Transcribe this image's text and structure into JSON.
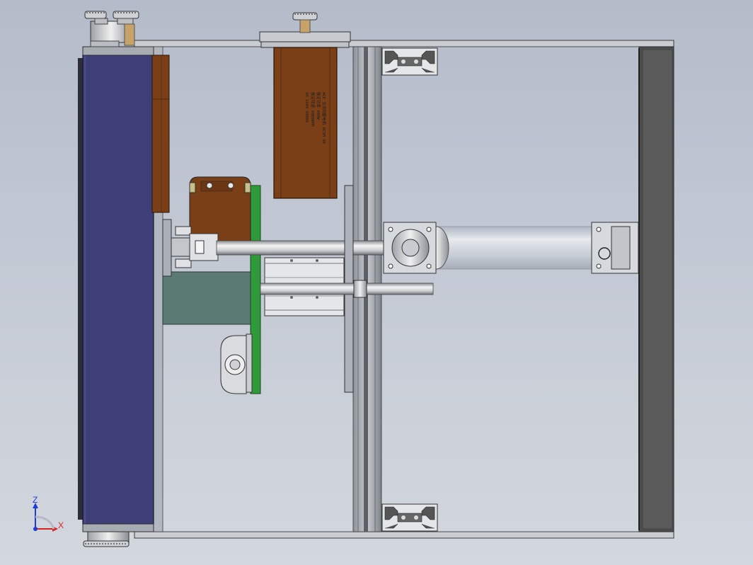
{
  "viewport": {
    "projection": "front view",
    "triad": {
      "z_label": "Z",
      "x_label": "X",
      "z_color": "#1f3bd6",
      "x_color": "#d62424"
    }
  },
  "model": {
    "components": [
      "frame-rail",
      "roller-belt",
      "drive-pulley",
      "servo-motor",
      "gearbox-bracket",
      "mounting-plate",
      "push-rod",
      "guide-cylinder",
      "linear-bearing",
      "aluminum-profile",
      "tie-rod",
      "pillow-block-bearing"
    ],
    "motor_label_lines": [
      "ACE 交流伺服电机 ACSM 90",
      "额定功率 400W",
      "额定转速 3000RPM",
      "SH 1604 3000R"
    ],
    "colors": {
      "frame": "#c8ccd2",
      "belt": "#3e3f78",
      "motor": "#7a3f17",
      "bracket_green": "#2f9a3a",
      "plate_teal": "#5c7a74",
      "rod": "#dcdcdc"
    }
  }
}
